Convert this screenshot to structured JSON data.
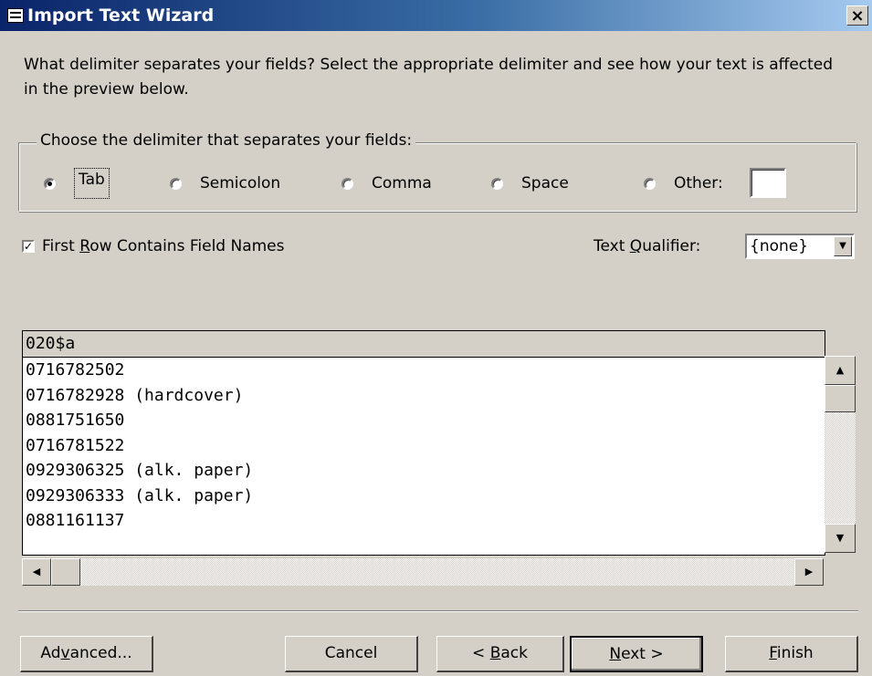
{
  "window": {
    "title": "Import Text Wizard",
    "close_glyph": "×"
  },
  "instructions": "What delimiter separates your fields? Select the appropriate delimiter and see how your text is affected in the preview below.",
  "delimiter_group": {
    "legend": "Choose the delimiter that separates your fields:",
    "options": [
      {
        "label": "Tab",
        "checked": true
      },
      {
        "label": "Semicolon",
        "checked": false
      },
      {
        "label": "Comma",
        "checked": false
      },
      {
        "label": "Space",
        "checked": false
      },
      {
        "label": "Other:",
        "checked": false
      }
    ],
    "other_value": ""
  },
  "first_row": {
    "label_prefix": "First ",
    "label_key": "R",
    "label_suffix": "ow Contains Field Names",
    "checked": true
  },
  "qualifier": {
    "label_prefix": "Text ",
    "label_key": "Q",
    "label_suffix": "ualifier:",
    "value": "{none}"
  },
  "preview": {
    "header": "020$a",
    "rows": [
      "0716782502",
      "0716782928 (hardcover)",
      "0881751650",
      "0716781522",
      "0929306325 (alk. paper)",
      "0929306333 (alk. paper)",
      "0881161137"
    ]
  },
  "buttons": {
    "advanced": {
      "prefix": "Ad",
      "key": "v",
      "suffix": "anced..."
    },
    "cancel": "Cancel",
    "back": {
      "prefix": "< ",
      "key": "B",
      "suffix": "ack"
    },
    "next": {
      "prefix": "",
      "key": "N",
      "suffix": "ext >"
    },
    "finish": {
      "prefix": "",
      "key": "F",
      "suffix": "inish"
    }
  },
  "icons": {
    "scroll_up": "▲",
    "scroll_down": "▼",
    "scroll_left": "◀",
    "scroll_right": "▶",
    "dropdown": "▼"
  }
}
